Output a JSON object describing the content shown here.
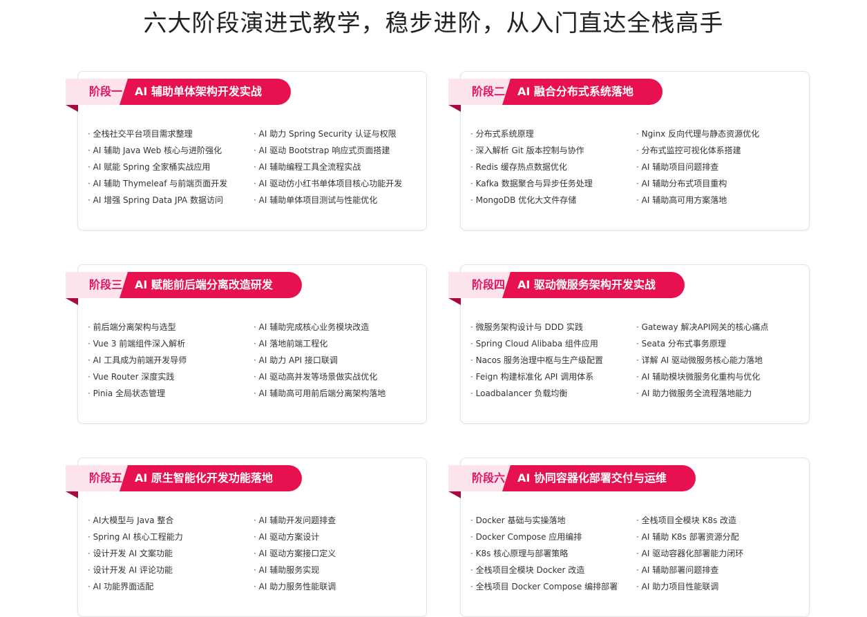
{
  "page": {
    "title": "六大阶段演进式教学，稳步进阶，从入门直达全栈高手"
  },
  "stages": [
    {
      "stage_label": "阶段一",
      "name": "AI 辅助单体架构开发实战",
      "left": [
        "全栈社交平台项目需求整理",
        "AI 辅助 Java Web 核心与进阶强化",
        "AI 赋能 Spring 全家桶实战应用",
        "AI 辅助 Thymeleaf 与前端页面开发",
        "AI 增强 Spring Data JPA 数据访问"
      ],
      "right": [
        "AI 助力 Spring Security 认证与权限",
        "AI 驱动 Bootstrap 响应式页面搭建",
        "AI 辅助编程工具全流程实战",
        "AI 驱动仿小红书单体项目核心功能开发",
        "AI 辅助单体项目测试与性能优化"
      ]
    },
    {
      "stage_label": "阶段二",
      "name": "AI 融合分布式系统落地",
      "left": [
        "分布式系统原理",
        "深入解析 Git 版本控制与协作",
        "Redis 缓存热点数据优化",
        "Kafka 数据聚合与异步任务处理",
        "MongoDB 优化大文件存储"
      ],
      "right": [
        "Nginx 反向代理与静态资源优化",
        "分布式监控可视化体系搭建",
        "AI 辅助项目问题排查",
        "AI 辅助分布式项目重构",
        "AI 辅助高可用方案落地"
      ]
    },
    {
      "stage_label": "阶段三",
      "name": "AI 赋能前后端分离改造研发",
      "left": [
        "前后端分离架构与选型",
        "Vue 3 前端组件深入解析",
        "AI 工具成为前端开发导师",
        "Vue Router 深度实践",
        "Pinia 全局状态管理"
      ],
      "right": [
        "AI 辅助完成核心业务模块改造",
        "AI 落地前端工程化",
        "AI 助力 API 接口联调",
        "AI 驱动高并发等场景做实战优化",
        "AI 辅助高可用前后端分离架构落地"
      ]
    },
    {
      "stage_label": "阶段四",
      "name": "AI 驱动微服务架构开发实战",
      "left": [
        "微服务架构设计与 DDD 实践",
        "Spring Cloud Alibaba 组件应用",
        "Nacos 服务治理中枢与生产级配置",
        "Feign 构建标准化 API 调用体系",
        "Loadbalancer 负载均衡"
      ],
      "right": [
        "Gateway 解决API网关的核心痛点",
        "Seata 分布式事务原理",
        "详解 AI 驱动微服务核心能力落地",
        "AI 辅助模块微服务化重构与优化",
        "AI 助力微服务全流程落地能力"
      ]
    },
    {
      "stage_label": "阶段五",
      "name": "AI 原生智能化开发功能落地",
      "left": [
        "AI大模型与 Java 整合",
        "Spring AI 核心工程能力",
        "设计开发 AI 文案功能",
        "设计开发 AI 评论功能",
        "AI 功能界面适配"
      ],
      "right": [
        "AI 辅助开发问题排查",
        "AI 驱动方案设计",
        "AI 驱动方案接口定义",
        "AI 辅助服务实现",
        "AI 助力服务性能联调"
      ]
    },
    {
      "stage_label": "阶段六",
      "name": "AI 协同容器化部署交付与运维",
      "left": [
        "Docker 基础与实操落地",
        "Docker Compose 应用编排",
        "K8s 核心原理与部署策略",
        "全栈项目全模块 Docker 改造",
        "全栈项目 Docker Compose 编排部署"
      ],
      "right": [
        "全栈项目全模块 K8s 改造",
        "AI 辅助 K8s 部署资源分配",
        "AI 驱动容器化部署能力闭环",
        "AI 辅助部署问题排查",
        "AI 助力项目性能联调"
      ]
    }
  ],
  "colors": {
    "accent": "#e8114f",
    "accent_light": "#fde4ec",
    "accent_dark": "#a80a3a"
  }
}
